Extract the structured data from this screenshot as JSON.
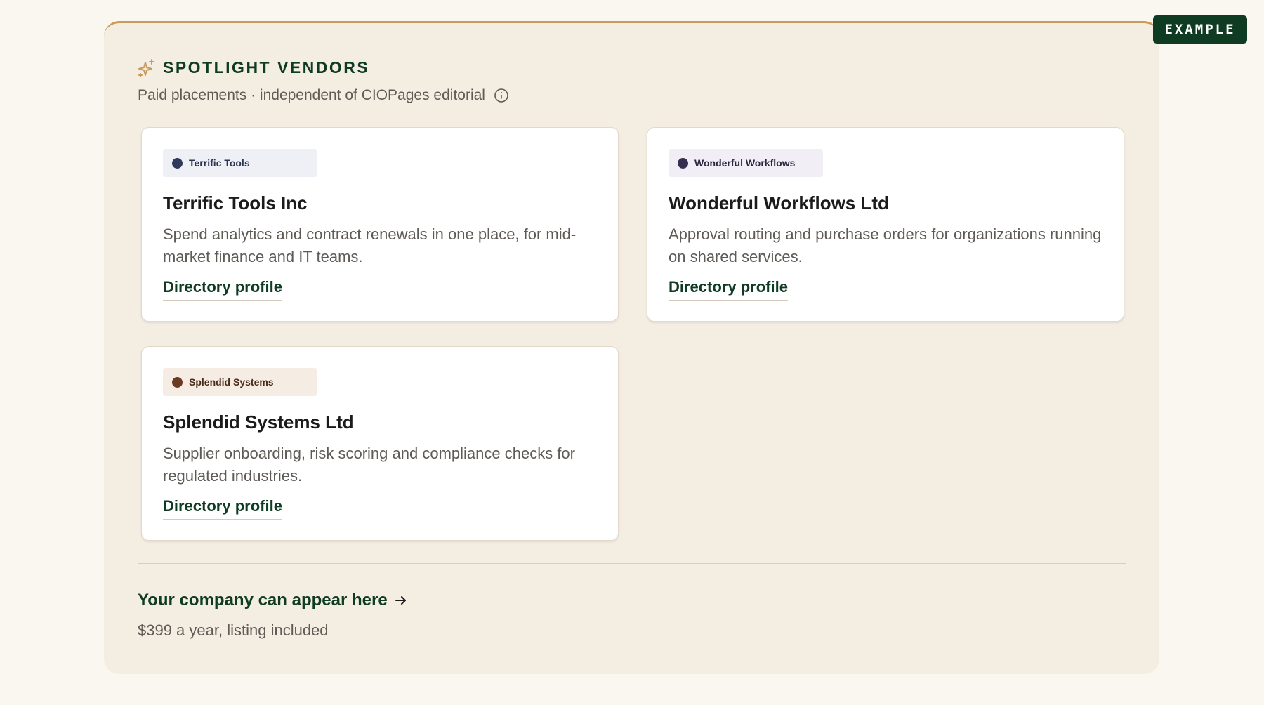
{
  "badge": {
    "label": "EXAMPLE"
  },
  "header": {
    "icon": "sparkle-icon",
    "title": "SPOTLIGHT VENDORS",
    "subtitle": "Paid placements · independent of CIOPages editorial",
    "info_icon": "info-icon"
  },
  "vendors": [
    {
      "tag": "Terrific Tools",
      "name": "Terrific Tools Inc",
      "description": "Spend analytics and contract renewals in one place, for mid-market finance and IT teams.",
      "link": "Directory profile",
      "tag_bg": "#eef0f6",
      "tag_color": "#2a3352",
      "dot_color": "#2e3a5c"
    },
    {
      "tag": "Wonderful Workflows",
      "name": "Wonderful Workflows Ltd",
      "description": "Approval routing and purchase orders for organizations running on shared services.",
      "link": "Directory profile",
      "tag_bg": "#f1eef5",
      "tag_color": "#2d2840",
      "dot_color": "#35304f"
    },
    {
      "tag": "Splendid Systems",
      "name": "Splendid Systems Ltd",
      "description": "Supplier onboarding, risk scoring and compliance checks for regulated industries.",
      "link": "Directory profile",
      "tag_bg": "#f5ece4",
      "tag_color": "#4a2a18",
      "dot_color": "#6b3a22"
    }
  ],
  "cta": {
    "link": "Your company can appear here",
    "arrow_icon": "arrow-right-icon",
    "price": "$399 a year, listing included"
  },
  "colors": {
    "page_bg": "#faf6f0",
    "panel_bg": "#f4ede2",
    "accent": "#c89a5c",
    "brand_green": "#0f3b23"
  }
}
